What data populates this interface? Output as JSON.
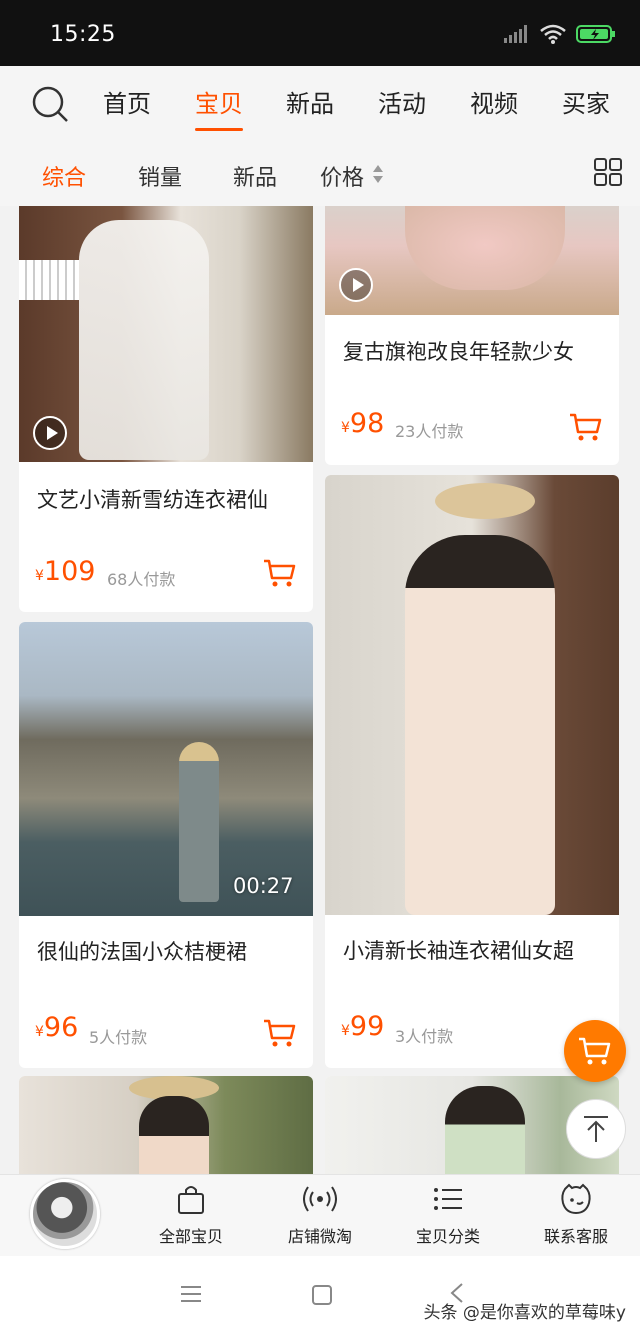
{
  "status_bar": {
    "time": "15:25"
  },
  "top_nav": {
    "tabs": [
      "首页",
      "宝贝",
      "新品",
      "活动",
      "视频",
      "买家"
    ],
    "active": "宝贝"
  },
  "sort_bar": {
    "tabs": [
      "综合",
      "销量",
      "新品",
      "价格"
    ],
    "active": "综合"
  },
  "products": [
    {
      "title": "文艺小清新雪纺连衣裙仙",
      "currency": "¥",
      "price": "109",
      "sales": "68人付款",
      "has_video": true
    },
    {
      "title": "复古旗袍改良年轻款少女",
      "currency": "¥",
      "price": "98",
      "sales": "23人付款",
      "has_video": true
    },
    {
      "title": "很仙的法国小众桔梗裙",
      "currency": "¥",
      "price": "96",
      "sales": "5人付款",
      "has_video": true,
      "duration": "00:27"
    },
    {
      "title": "小清新长袖连衣裙仙女超",
      "currency": "¥",
      "price": "99",
      "sales": "3人付款",
      "has_video": false
    }
  ],
  "shop_bar": {
    "items": [
      {
        "label": "全部宝贝",
        "icon": "bag-icon"
      },
      {
        "label": "店铺微淘",
        "icon": "broadcast-icon"
      },
      {
        "label": "宝贝分类",
        "icon": "list-icon"
      },
      {
        "label": "联系客服",
        "icon": "chat-icon"
      }
    ]
  },
  "watermark": "头条 @是你喜欢的草莓味y",
  "colors": {
    "accent": "#ff5000",
    "fab": "#ff7a00",
    "status_bar": "#111111"
  }
}
